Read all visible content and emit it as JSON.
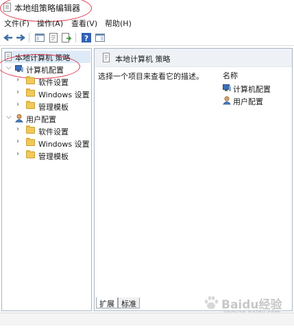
{
  "window": {
    "title": "本地组策略编辑器"
  },
  "menu": [
    "文件(F)",
    "操作(A)",
    "查看(V)",
    "帮助(H)"
  ],
  "toolbar": {
    "buttons": [
      "back-arrow-icon",
      "forward-arrow-icon",
      "console-tree-icon",
      "properties-icon",
      "export-list-icon",
      "help-icon",
      "show-hide-pane-icon"
    ]
  },
  "tree": {
    "root": "本地计算机 策略",
    "computer": {
      "label": "计算机配置",
      "children": [
        "软件设置",
        "Windows 设置",
        "管理模板"
      ]
    },
    "user": {
      "label": "用户配置",
      "children": [
        "软件设置",
        "Windows 设置",
        "管理模板"
      ]
    }
  },
  "detail": {
    "header": "本地计算机 策略",
    "description": "选择一个项目来查看它的描述。",
    "column_name": "名称",
    "items": [
      "计算机配置",
      "用户配置"
    ]
  },
  "tabs": [
    "扩展",
    "标准"
  ],
  "watermark": {
    "brand": "Baidu经验",
    "url": "jingyan.baidu.com"
  },
  "colors": {
    "annotation": "#e0344a",
    "pane_border": "#a9b4c2",
    "header_bg": "#eef2f7"
  }
}
